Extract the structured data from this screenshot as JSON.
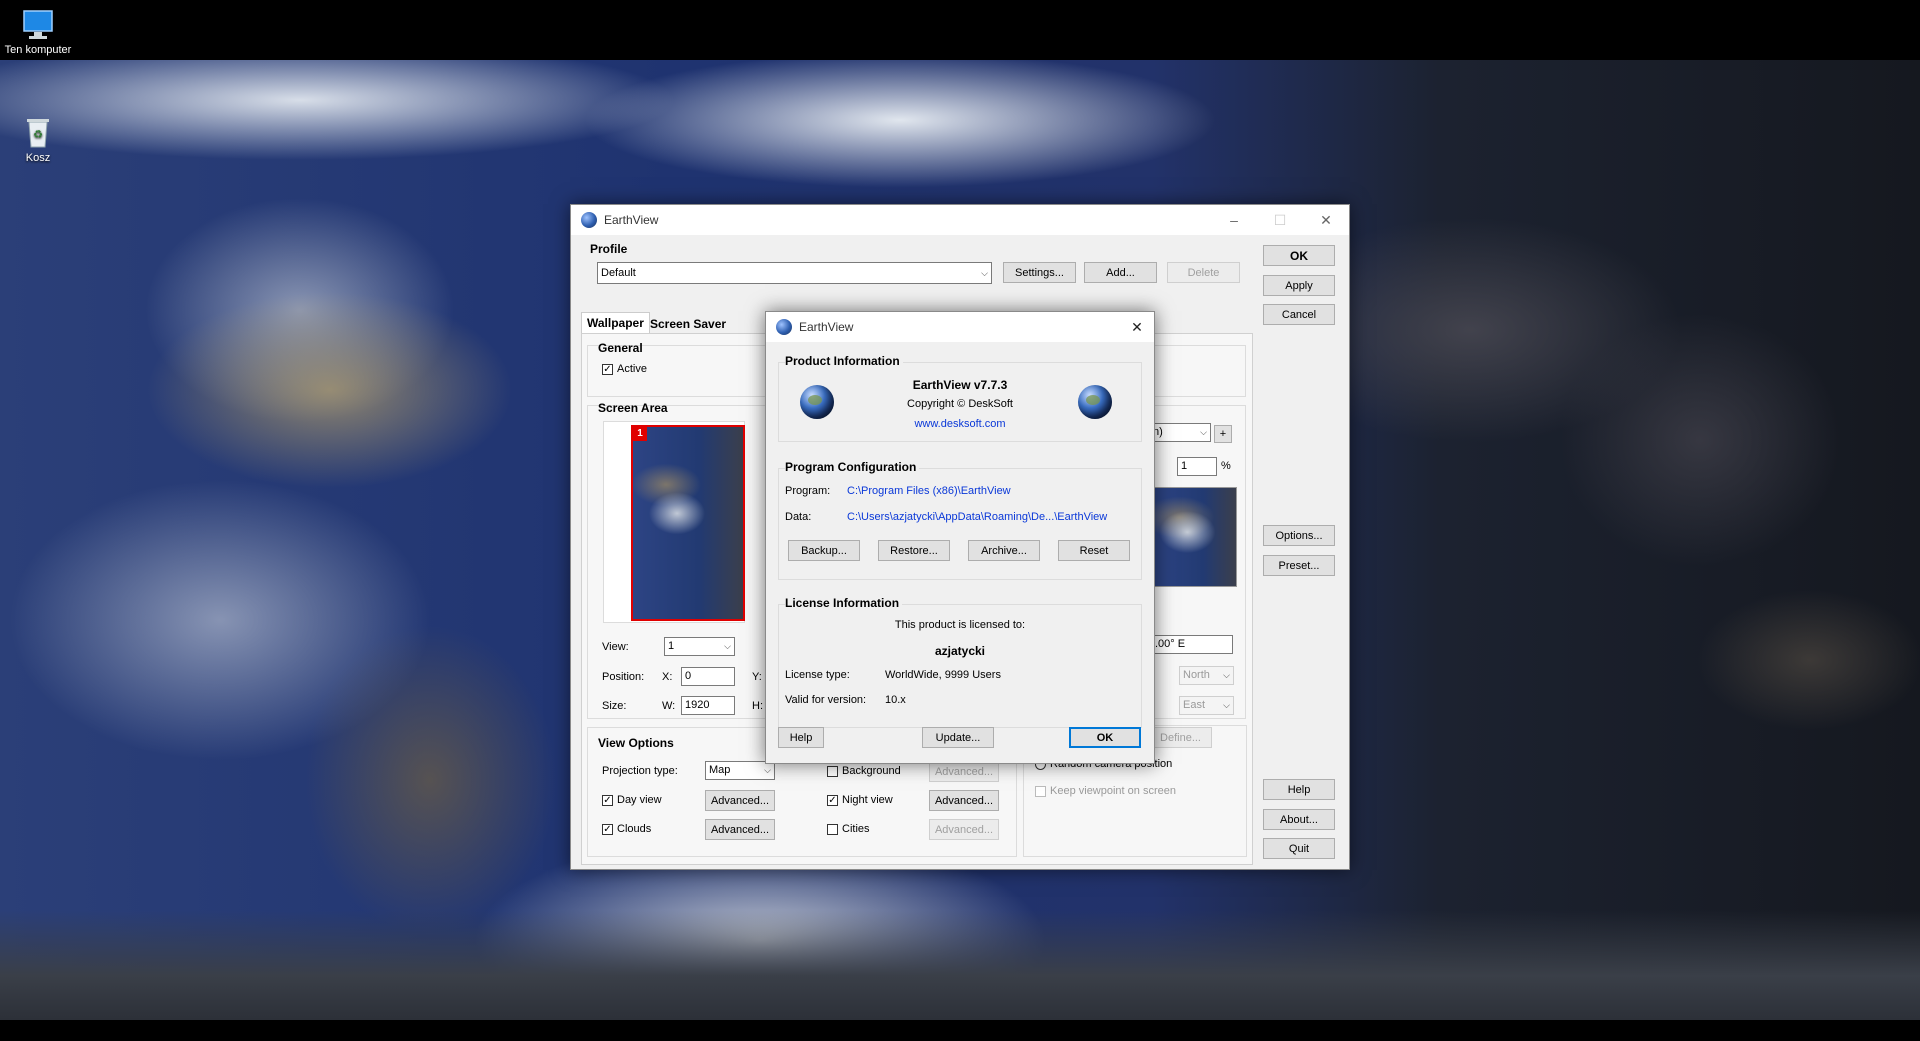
{
  "desktop": {
    "icons": [
      {
        "label": "Ten komputer",
        "icon": "computer-icon"
      },
      {
        "label": "Kosz",
        "icon": "recycle-bin-icon"
      }
    ]
  },
  "main_window": {
    "title": "EarthView",
    "profile": {
      "heading": "Profile",
      "value": "Default",
      "settings_label": "Settings...",
      "add_label": "Add...",
      "delete_label": "Delete"
    },
    "side_buttons": {
      "ok": "OK",
      "apply": "Apply",
      "cancel": "Cancel",
      "options": "Options...",
      "preset": "Preset...",
      "help": "Help",
      "about": "About...",
      "quit": "Quit"
    },
    "tabs": [
      "Wallpaper",
      "Screen Saver"
    ],
    "general": {
      "heading": "General",
      "active_label": "Active",
      "active_checked": true
    },
    "screen_area": {
      "heading": "Screen Area",
      "monitor_badge": "1",
      "view_label": "View:",
      "view_value": "1",
      "position_label": "Position:",
      "x_label": "X:",
      "x_value": "0",
      "y_label": "Y:",
      "size_label": "Size:",
      "w_label": "W:",
      "w_value": "1920",
      "h_label": "H:"
    },
    "right_panel": {
      "combo_value": "n)",
      "plus_label": "+",
      "percent_value": "1",
      "percent_sign": "%",
      "longitude_value": ".00° E",
      "north_value": "North",
      "east_value": "East",
      "define_label": "Define...",
      "random_camera_label": "Random camera position",
      "keep_viewpoint_label": "Keep viewpoint on screen"
    },
    "view_options": {
      "heading": "View Options",
      "projection_label": "Projection type:",
      "projection_value": "Map",
      "background_label": "Background",
      "background_checked": false,
      "day_view_label": "Day view",
      "day_view_checked": true,
      "night_view_label": "Night view",
      "night_view_checked": true,
      "clouds_label": "Clouds",
      "clouds_checked": true,
      "cities_label": "Cities",
      "cities_checked": false,
      "advanced_label": "Advanced..."
    }
  },
  "about_dialog": {
    "title": "EarthView",
    "close_glyph": "✕",
    "product_info": {
      "heading": "Product Information",
      "name": "EarthView v7.7.3",
      "copyright": "Copyright © DeskSoft",
      "website": "www.desksoft.com"
    },
    "program_config": {
      "heading": "Program Configuration",
      "program_label": "Program:",
      "program_path": "C:\\Program Files (x86)\\EarthView",
      "data_label": "Data:",
      "data_path": "C:\\Users\\azjatycki\\AppData\\Roaming\\De...\\EarthView",
      "backup_label": "Backup...",
      "restore_label": "Restore...",
      "archive_label": "Archive...",
      "reset_label": "Reset"
    },
    "license_info": {
      "heading": "License Information",
      "licensed_to_label": "This product is licensed to:",
      "user": "azjatycki",
      "license_type_label": "License type:",
      "license_type": "WorldWide, 9999 Users",
      "valid_for_label": "Valid for version:",
      "valid_for": "10.x"
    },
    "help_label": "Help",
    "update_label": "Update...",
    "ok_label": "OK"
  }
}
